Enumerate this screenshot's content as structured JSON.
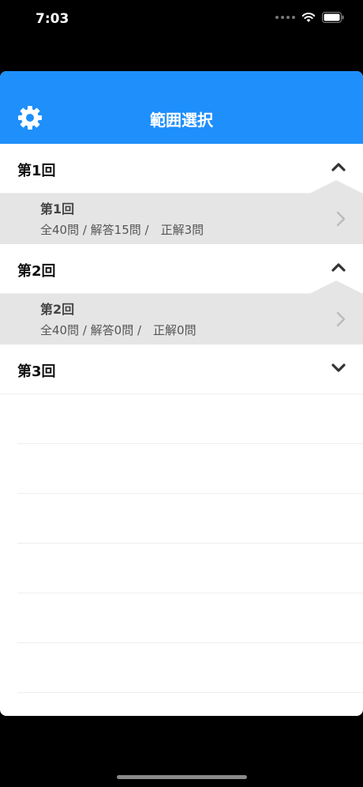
{
  "status_bar": {
    "time": "7:03"
  },
  "nav": {
    "title": "範囲選択"
  },
  "sections": [
    {
      "title": "第1回",
      "state": "expanded",
      "row": {
        "title": "第1回",
        "subtitle": "全40問 / 解答15問 /　正解3問"
      }
    },
    {
      "title": "第2回",
      "state": "expanded",
      "row": {
        "title": "第2回",
        "subtitle": "全40問 / 解答0問 /　正解0問"
      }
    },
    {
      "title": "第3回",
      "state": "collapsed"
    }
  ],
  "colors": {
    "nav_bar": "#1e8ffb",
    "expanded_row": "#e5e5e5"
  },
  "icons": {
    "settings": "gear-icon",
    "expanded": "chevron-up-icon",
    "collapsed": "chevron-down-icon",
    "disclosure": "chevron-right-icon"
  }
}
